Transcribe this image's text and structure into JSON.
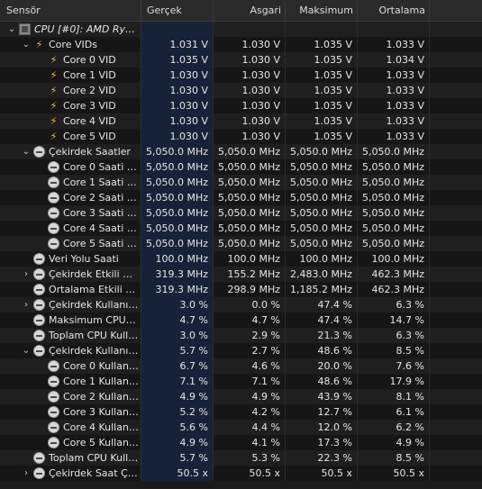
{
  "columns": [
    "Sensör",
    "Gerçek",
    "Asgari",
    "Maksimum",
    "Ortalama"
  ],
  "rows": [
    {
      "indent": 0,
      "exp": "⌄",
      "icon": "chip",
      "label": "CPU [#0]: AMD Ryz...",
      "v": [
        "",
        "",
        "",
        ""
      ],
      "cpu": true
    },
    {
      "indent": 1,
      "exp": "⌄",
      "icon": "bolt",
      "label": "Core VIDs",
      "v": [
        "1.031 V",
        "1.030 V",
        "1.035 V",
        "1.033 V"
      ]
    },
    {
      "indent": 2,
      "exp": "",
      "icon": "bolt",
      "label": "Core 0 VID",
      "v": [
        "1.035 V",
        "1.030 V",
        "1.035 V",
        "1.034 V"
      ]
    },
    {
      "indent": 2,
      "exp": "",
      "icon": "bolt",
      "label": "Core 1 VID",
      "v": [
        "1.030 V",
        "1.030 V",
        "1.035 V",
        "1.033 V"
      ]
    },
    {
      "indent": 2,
      "exp": "",
      "icon": "bolt",
      "label": "Core 2 VID",
      "v": [
        "1.030 V",
        "1.030 V",
        "1.035 V",
        "1.033 V"
      ]
    },
    {
      "indent": 2,
      "exp": "",
      "icon": "bolt",
      "label": "Core 3 VID",
      "v": [
        "1.030 V",
        "1.030 V",
        "1.035 V",
        "1.033 V"
      ]
    },
    {
      "indent": 2,
      "exp": "",
      "icon": "bolt",
      "label": "Core 4 VID",
      "v": [
        "1.030 V",
        "1.030 V",
        "1.035 V",
        "1.033 V"
      ]
    },
    {
      "indent": 2,
      "exp": "",
      "icon": "bolt",
      "label": "Core 5 VID",
      "v": [
        "1.030 V",
        "1.030 V",
        "1.035 V",
        "1.033 V"
      ]
    },
    {
      "indent": 1,
      "exp": "⌄",
      "icon": "clock",
      "label": "Çekirdek Saatler",
      "v": [
        "5,050.0 MHz",
        "5,050.0 MHz",
        "5,050.0 MHz",
        "5,050.0 MHz"
      ]
    },
    {
      "indent": 2,
      "exp": "",
      "icon": "clock",
      "label": "Core 0 Saati (per...",
      "v": [
        "5,050.0 MHz",
        "5,050.0 MHz",
        "5,050.0 MHz",
        "5,050.0 MHz"
      ]
    },
    {
      "indent": 2,
      "exp": "",
      "icon": "clock",
      "label": "Core 1 Saati (per...",
      "v": [
        "5,050.0 MHz",
        "5,050.0 MHz",
        "5,050.0 MHz",
        "5,050.0 MHz"
      ]
    },
    {
      "indent": 2,
      "exp": "",
      "icon": "clock",
      "label": "Core 2 Saati (per...",
      "v": [
        "5,050.0 MHz",
        "5,050.0 MHz",
        "5,050.0 MHz",
        "5,050.0 MHz"
      ]
    },
    {
      "indent": 2,
      "exp": "",
      "icon": "clock",
      "label": "Core 3 Saati (per...",
      "v": [
        "5,050.0 MHz",
        "5,050.0 MHz",
        "5,050.0 MHz",
        "5,050.0 MHz"
      ]
    },
    {
      "indent": 2,
      "exp": "",
      "icon": "clock",
      "label": "Core 4 Saati (per...",
      "v": [
        "5,050.0 MHz",
        "5,050.0 MHz",
        "5,050.0 MHz",
        "5,050.0 MHz"
      ]
    },
    {
      "indent": 2,
      "exp": "",
      "icon": "clock",
      "label": "Core 5 Saati (per...",
      "v": [
        "5,050.0 MHz",
        "5,050.0 MHz",
        "5,050.0 MHz",
        "5,050.0 MHz"
      ]
    },
    {
      "indent": 1,
      "exp": "",
      "icon": "clock",
      "label": "Veri Yolu Saati",
      "v": [
        "100.0 MHz",
        "100.0 MHz",
        "100.0 MHz",
        "100.0 MHz"
      ]
    },
    {
      "indent": 1,
      "exp": "›",
      "icon": "clock",
      "label": "Çekirdek Etkili Sa...",
      "v": [
        "319.3 MHz",
        "155.2 MHz",
        "2,483.0 MHz",
        "462.3 MHz"
      ]
    },
    {
      "indent": 1,
      "exp": "",
      "icon": "clock",
      "label": "Ortalama Etkili Saat",
      "v": [
        "319.3 MHz",
        "298.9 MHz",
        "1,185.2 MHz",
        "462.3 MHz"
      ]
    },
    {
      "indent": 1,
      "exp": "›",
      "icon": "clock",
      "label": "Çekirdek Kullanımı",
      "v": [
        "3.0 %",
        "0.0 %",
        "47.4 %",
        "6.3 %"
      ]
    },
    {
      "indent": 1,
      "exp": "",
      "icon": "clock",
      "label": "Maksimum CPU/İş pa...",
      "v": [
        "4.7 %",
        "4.7 %",
        "47.4 %",
        "14.7 %"
      ]
    },
    {
      "indent": 1,
      "exp": "",
      "icon": "clock",
      "label": "Toplam CPU Kullanımı",
      "v": [
        "3.0 %",
        "2.9 %",
        "21.3 %",
        "6.3 %"
      ]
    },
    {
      "indent": 1,
      "exp": "⌄",
      "icon": "clock",
      "label": "Çekirdek Kullanımı",
      "v": [
        "5.7 %",
        "2.7 %",
        "48.6 %",
        "8.5 %"
      ]
    },
    {
      "indent": 2,
      "exp": "",
      "icon": "clock",
      "label": "Core 0 Kullanım",
      "v": [
        "6.7 %",
        "4.6 %",
        "20.0 %",
        "7.6 %"
      ]
    },
    {
      "indent": 2,
      "exp": "",
      "icon": "clock",
      "label": "Core 1 Kullanım",
      "v": [
        "7.1 %",
        "7.1 %",
        "48.6 %",
        "17.9 %"
      ]
    },
    {
      "indent": 2,
      "exp": "",
      "icon": "clock",
      "label": "Core 2 Kullanım",
      "v": [
        "4.9 %",
        "4.9 %",
        "43.9 %",
        "8.1 %"
      ]
    },
    {
      "indent": 2,
      "exp": "",
      "icon": "clock",
      "label": "Core 3 Kullanım",
      "v": [
        "5.2 %",
        "4.2 %",
        "12.7 %",
        "6.1 %"
      ]
    },
    {
      "indent": 2,
      "exp": "",
      "icon": "clock",
      "label": "Core 4 Kullanım",
      "v": [
        "5.6 %",
        "4.4 %",
        "12.0 %",
        "6.2 %"
      ]
    },
    {
      "indent": 2,
      "exp": "",
      "icon": "clock",
      "label": "Core 5 Kullanım",
      "v": [
        "4.9 %",
        "4.1 %",
        "17.3 %",
        "4.9 %"
      ]
    },
    {
      "indent": 1,
      "exp": "",
      "icon": "clock",
      "label": "Toplam CPU Kullanımı",
      "v": [
        "5.7 %",
        "5.3 %",
        "22.3 %",
        "8.5 %"
      ]
    },
    {
      "indent": 1,
      "exp": "›",
      "icon": "clock",
      "label": "Çekirdek Saat Ça...",
      "v": [
        "50.5 x",
        "50.5 x",
        "50.5 x",
        "50.5 x"
      ]
    }
  ]
}
